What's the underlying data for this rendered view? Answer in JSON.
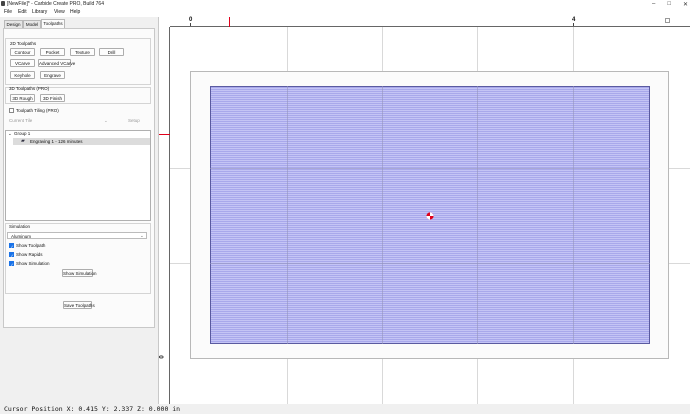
{
  "window": {
    "title": "[NewFile]* - Carbide Create PRO, Build 764",
    "controls": [
      "–",
      "□",
      "✕"
    ]
  },
  "menu": [
    "File",
    "Edit",
    "Library",
    "View",
    "Help"
  ],
  "tabs": [
    "Design",
    "Model",
    "Toolpaths"
  ],
  "toolpaths_2d": {
    "title": "2D Toolpaths",
    "buttons": [
      "Contour",
      "Pocket",
      "Texture",
      "Drill",
      "VCarve",
      "Advanced VCarve",
      "Keyhole",
      "Engrave"
    ]
  },
  "toolpaths_3d": {
    "title": "3D Toolpaths (PRO)",
    "buttons": [
      "3D Rough",
      "3D Finish"
    ]
  },
  "tiling": {
    "label": "Toolpath Tiling (PRO)",
    "current_tile": "Current Tile",
    "setup": "Setup"
  },
  "tree": {
    "group": "Group 1",
    "item": "Engraving 1 - 126 minutes"
  },
  "simulation": {
    "title": "Simulation",
    "material": "Aluminum",
    "show_toolpath": "Show Toolpath",
    "show_rapids": "Show Rapids",
    "show_simulation_chk": "Show Simulation",
    "show_simulation_btn": "Show Simulation"
  },
  "save_toolpaths": "Save Toolpaths",
  "ruler": {
    "top": [
      "0",
      "4"
    ],
    "left": [
      "0"
    ]
  },
  "status": "Cursor Position X: 0.415 Y: 2.337 Z: 0.000 in",
  "colors": {
    "hatch": "#c4c4f5",
    "accent": "#e0001b",
    "check": "#1a73e8"
  }
}
